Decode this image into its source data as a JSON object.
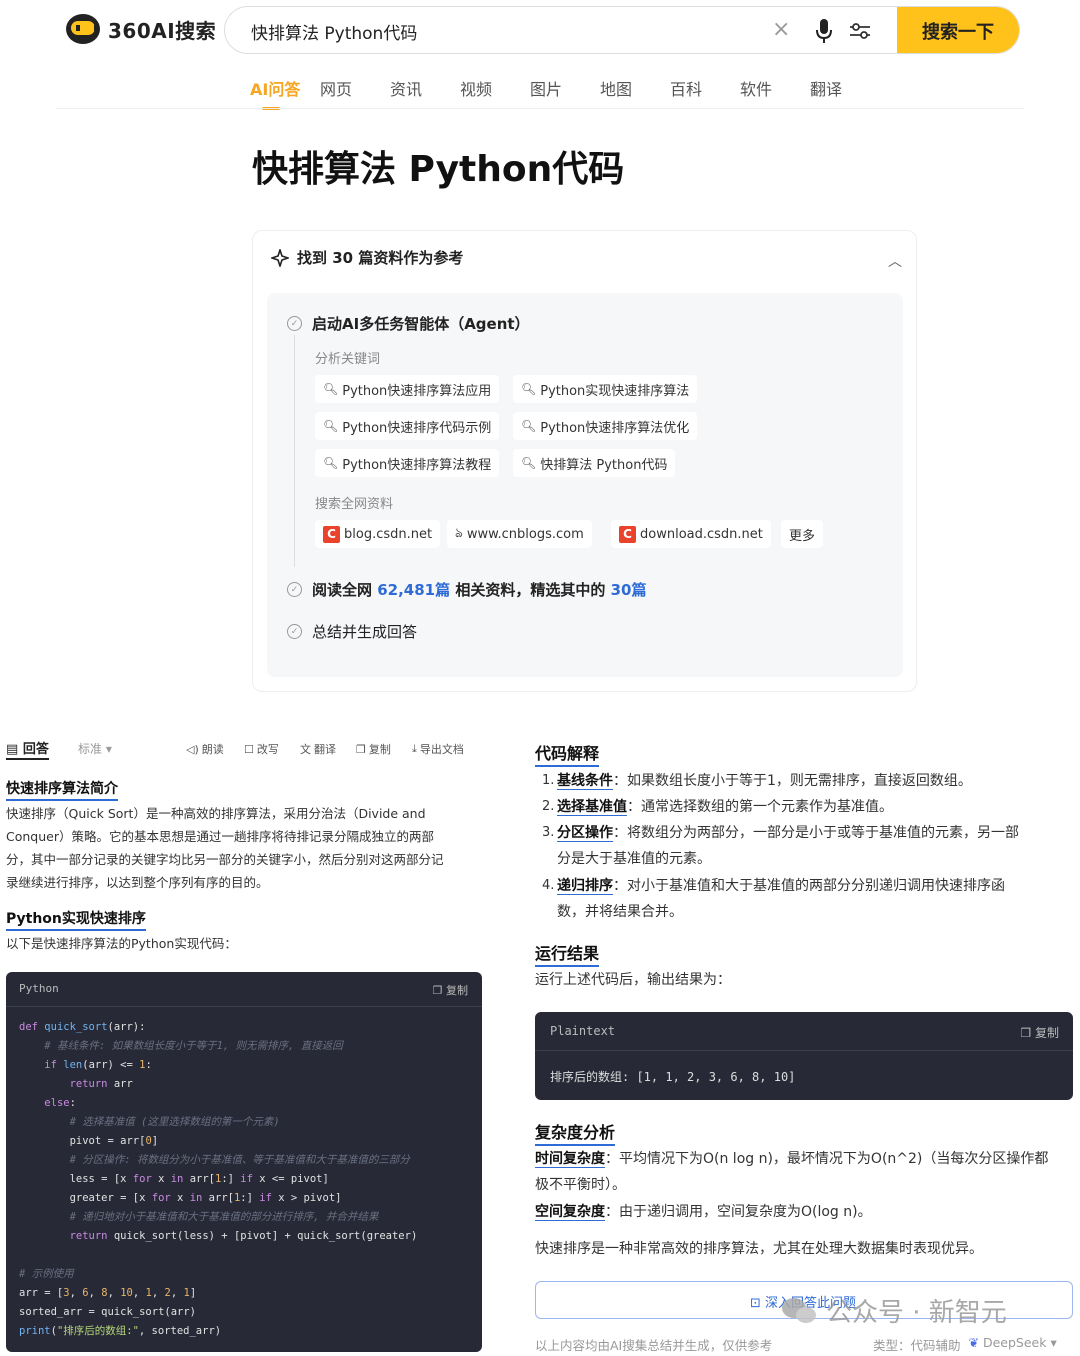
{
  "header": {
    "logo_text": "360AI搜索",
    "search_value": "快排算法 Python代码",
    "search_button": "搜索一下"
  },
  "tabs": [
    "AI问答",
    "网页",
    "资讯",
    "视频",
    "图片",
    "地图",
    "百科",
    "软件",
    "翻译"
  ],
  "page_title": "快排算法 Python代码",
  "reference": {
    "header": "找到 30 篇资料作为参考",
    "step1": "启动AI多任务智能体（Agent）",
    "keywords_label": "分析关键词",
    "keywords": [
      "Python快速排序算法应用",
      "Python实现快速排序算法",
      "Python快速排序代码示例",
      "Python快速排序算法优化",
      "Python快速排序算法教程",
      "快排算法 Python代码"
    ],
    "search_label": "搜索全网资料",
    "sites": [
      "blog.csdn.net",
      "www.cnblogs.com",
      "download.csdn.net"
    ],
    "more": "更多",
    "step2_pre": "阅读全网 ",
    "step2_count": "62,481篇",
    "step2_mid": " 相关资料，精选其中的 ",
    "step2_pick": "30篇",
    "step3": "总结并生成回答"
  },
  "answer_toolbar": {
    "answer": "回答",
    "standard": "标准",
    "read": "朗读",
    "rewrite": "改写",
    "translate": "翻译",
    "copy": "复制",
    "export": "导出文档"
  },
  "left": {
    "intro_title": "快速排序算法简介",
    "intro_lines": [
      "快速排序（Quick Sort）是一种高效的排序算法，采用分治法（Divide and",
      "Conquer）策略。它的基本思想是通过一趟排序将待排记录分隔成独立的两部",
      "分，其中一部分记录的关键字均比另一部分的关键字小，然后分别对这两部分记",
      "录继续进行排序，以达到整个序列有序的目的。"
    ],
    "impl_title": "Python实现快速排序",
    "impl_text": "以下是快速排序算法的Python实现代码：",
    "code_lang": "Python",
    "code_copy": "复制"
  },
  "right": {
    "explain_title": "代码解释",
    "explain_items": [
      {
        "num": "1.",
        "term": "基线条件",
        "text": "：如果数组长度小于等于1，则无需排序，直接返回数组。",
        "text2": ""
      },
      {
        "num": "2.",
        "term": "选择基准值",
        "text": "：通常选择数组的第一个元素作为基准值。",
        "text2": ""
      },
      {
        "num": "3.",
        "term": "分区操作",
        "text": "：将数组分为两部分，一部分是小于或等于基准值的元素，另一部",
        "text2": "分是大于基准值的元素。"
      },
      {
        "num": "4.",
        "term": "递归排序",
        "text": "：对小于基准值和大于基准值的两部分分别递归调用快速排序函",
        "text2": "数，并将结果合并。"
      }
    ],
    "result_title": "运行结果",
    "result_text": "运行上述代码后，输出结果为：",
    "plain_lang": "Plaintext",
    "plain_copy": "复制",
    "plain_output": "排序后的数组: [1, 1, 2, 3, 6, 8, 10]",
    "complex_title": "复杂度分析",
    "time_term": "时间复杂度",
    "time_text": "：平均情况下为O(n log n)，最坏情况下为O(n^2)（当每次分区操作都",
    "time_text2": "极不平衡时）。",
    "space_term": "空间复杂度",
    "space_text": "：由于递归调用，空间复杂度为O(log n)。",
    "summary": "快速排序是一种非常高效的排序算法，尤其在处理大数据集时表现优异。",
    "deep_button": "深入回答此问题",
    "footer_note": "以上内容均由AI搜集总结并生成，仅供参考",
    "footer_type": "类型：代码辅助",
    "footer_model": "DeepSeek"
  },
  "watermark": "公众号 · 新智元"
}
